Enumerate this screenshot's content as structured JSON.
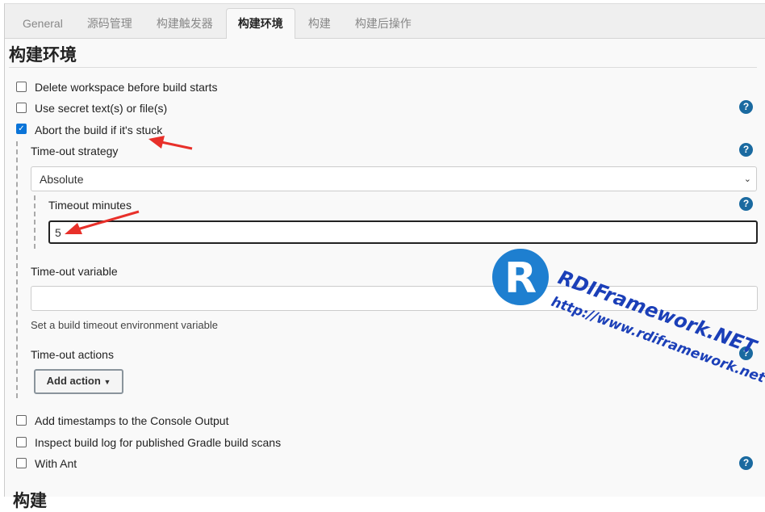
{
  "tabs": [
    {
      "label": "General"
    },
    {
      "label": "源码管理"
    },
    {
      "label": "构建触发器"
    },
    {
      "label": "构建环境",
      "active": true
    },
    {
      "label": "构建"
    },
    {
      "label": "构建后操作"
    }
  ],
  "section_title": "构建环境",
  "options": {
    "delete_workspace": {
      "label": "Delete workspace before build starts",
      "checked": false
    },
    "secret_text": {
      "label": "Use secret text(s) or file(s)",
      "checked": false
    },
    "abort_stuck": {
      "label": "Abort the build if it's stuck",
      "checked": true
    }
  },
  "timeout": {
    "strategy_label": "Time-out strategy",
    "strategy_value": "Absolute",
    "minutes_label": "Timeout minutes",
    "minutes_value": "5",
    "variable_label": "Time-out variable",
    "variable_value": "",
    "variable_hint": "Set a build timeout environment variable",
    "actions_label": "Time-out actions",
    "add_action": "Add action"
  },
  "more_options": {
    "timestamps": {
      "label": "Add timestamps to the Console Output",
      "checked": false
    },
    "gradle": {
      "label": "Inspect build log for published Gradle build scans",
      "checked": false
    },
    "ant": {
      "label": "With Ant",
      "checked": false
    }
  },
  "next_section_title": "构建",
  "help_icon": "?",
  "watermark": {
    "title": "RDIFramework.NET",
    "url": "http://www.rdiframework.net"
  },
  "colors": {
    "accent": "#0a74d8",
    "help": "#1a6aa0",
    "annotation": "#e8302a"
  }
}
